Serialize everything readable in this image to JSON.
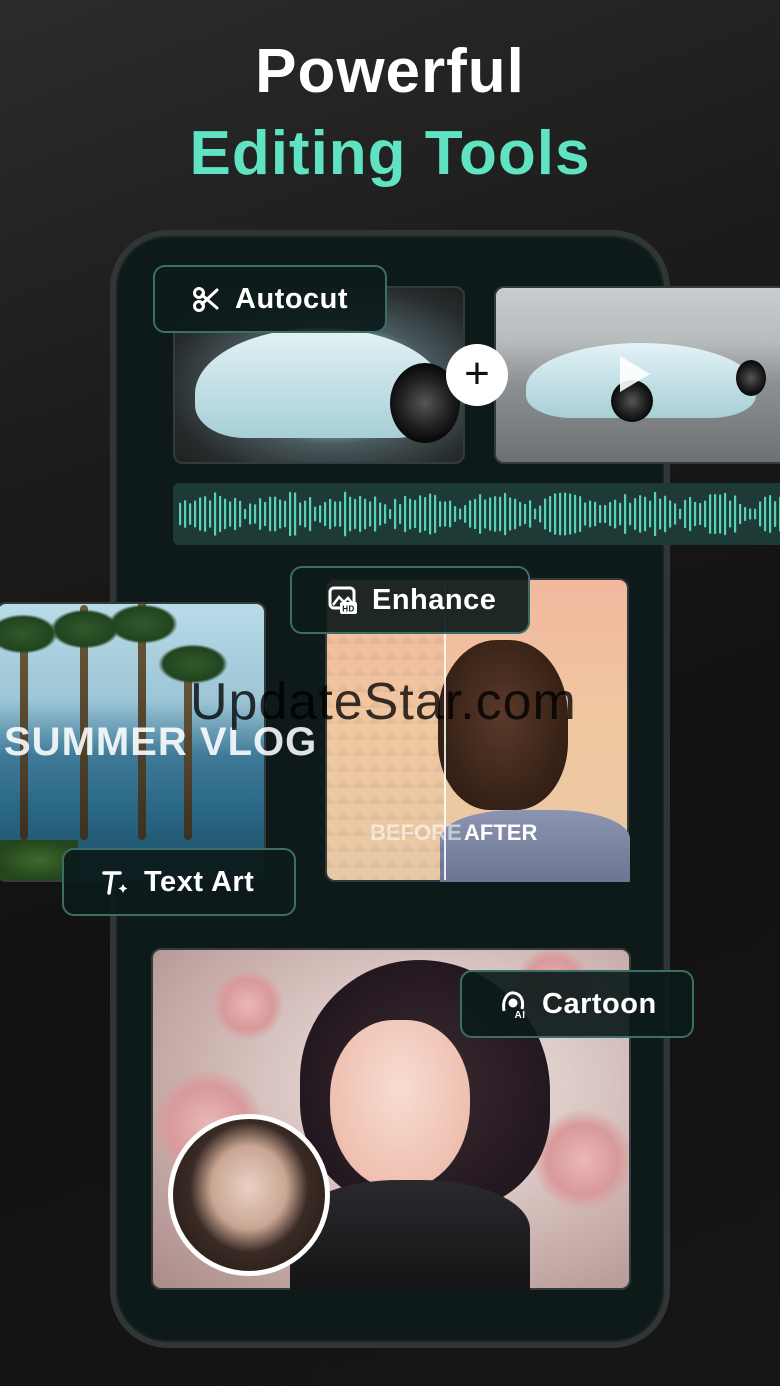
{
  "header": {
    "line1": "Powerful",
    "line2": "Editing Tools"
  },
  "features": {
    "autocut": "Autocut",
    "enhance": "Enhance",
    "text_art": "Text Art",
    "cartoon": "Cartoon"
  },
  "clips": {
    "add_symbol": "+"
  },
  "text_art_sample": "SUMMER VLOG",
  "enhance_labels": {
    "before": "BEFORE",
    "after": "AFTER"
  },
  "watermark": "UpdateStar.com",
  "icons": {
    "autocut": "scissors-icon",
    "enhance": "hd-image-icon",
    "text_art": "text-sparkle-icon",
    "cartoon": "ai-avatar-icon"
  },
  "colors": {
    "accent": "#5fe3c2",
    "pill_border": "#3c6e66",
    "wave": "#5fe3c2"
  }
}
